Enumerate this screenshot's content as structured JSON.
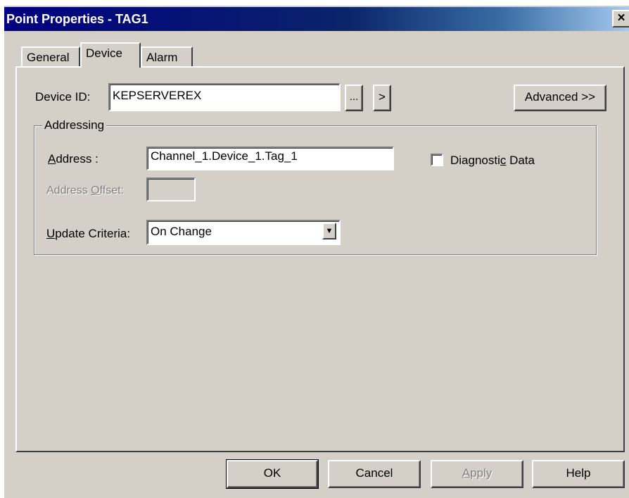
{
  "window": {
    "title": "Point Properties - TAG1",
    "close_glyph": "×"
  },
  "tabs": [
    {
      "label": "General",
      "active": false
    },
    {
      "label": "Device",
      "active": true
    },
    {
      "label": "Alarm",
      "active": false
    }
  ],
  "device": {
    "id_label_pre": "Device ID:",
    "id_value": "KEPSERVEREX",
    "browse_label": "...",
    "next_label": ">",
    "advanced_label": "Advanced >>"
  },
  "addressing": {
    "group_label": "Addressing",
    "address_label_u": "A",
    "address_label_rest": "ddress :",
    "address_value": "Channel_1.Device_1.Tag_1",
    "offset_label_pre": "Address ",
    "offset_label_u": "O",
    "offset_label_post": "ffset:",
    "offset_value": "",
    "update_label_u": "U",
    "update_label_rest": "pdate Criteria:",
    "update_value": "On Change",
    "diag_label_pre": "Diagnosti",
    "diag_label_u": "c",
    "diag_label_post": " Data",
    "diag_checked": false
  },
  "buttons": {
    "ok": "OK",
    "cancel": "Cancel",
    "apply_u": "A",
    "apply_rest": "pply",
    "help": "Help"
  }
}
